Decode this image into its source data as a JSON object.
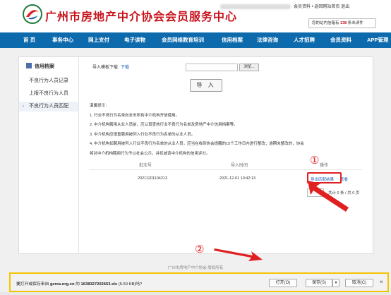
{
  "header": {
    "site_title": "广州市房地产中介协会会员服务中心",
    "top_links": "会员资料 • 返回网站首页  退出",
    "mail_prefix": "您的站内信箱有",
    "mail_count": "138",
    "mail_suffix": "条未读件"
  },
  "nav": {
    "items": [
      "首 页",
      "事务中心",
      "网上支付",
      "电子读物",
      "会员网络教育培训",
      "信用档案",
      "法律咨询",
      "人才招聘",
      "会员资料",
      "APP管理"
    ]
  },
  "sidebar": {
    "heading": "信用档案",
    "items": [
      "不良行为人员记录",
      "上报不良行为人员",
      "不良行为人员匹配"
    ]
  },
  "upload": {
    "template_label": "导入模板下载",
    "template_link": "下载",
    "browse_label": "浏览...",
    "import_label": "导 入"
  },
  "tips": {
    "title": "温馨提示：",
    "lines": [
      "1. 行业不良行为名单向全市所有中介机构开放使用。",
      "2. 中介机构聘用从业人员前，应认真查核行业不良行为名单及房地产中介信用档案等。",
      "3. 中介机构应慎重聘用被列入行业不良行为名单的从业人员。",
      "4. 中介机构如聘用被列入行业不良行为名单的从业人员，应当在收到协会提醒的15个工作日内进行整改；逾期未整改的，协会",
      "将对中介机构聘用行为予以社会公示，并扣减该中介机构的信用评分。"
    ]
  },
  "table": {
    "headers": [
      "批次号",
      "导入时间",
      "操作"
    ],
    "rows": [
      {
        "batch": "20211201104213",
        "time": "2021-12-01 10:42:13",
        "action_export": "导出匹配结果",
        "action_view": "查看"
      }
    ]
  },
  "pager": {
    "page_value": "1...",
    "text": "共计 0 条 / 共 0 页"
  },
  "annotations": {
    "marker_1": "①",
    "marker_2": "②",
    "color": "#e02020"
  },
  "footer": {
    "text": "广州市房地产中介协会 版权所有"
  },
  "download_bar": {
    "prompt_prefix": "要打开或保存来自",
    "domain": "gzrea.org.cn",
    "prompt_mid": "的",
    "filename": "1638327202653.xls",
    "size": "(5.50 KB)吗?",
    "open_label": "打开(O)",
    "save_label": "保存(S)",
    "cancel_label": "取消(C)",
    "close_glyph": "×"
  },
  "colors": {
    "brand_red": "#c8121b",
    "nav_blue": "#0d6aad",
    "link_blue": "#1a5fb4",
    "highlight_yellow": "#f5c400"
  }
}
